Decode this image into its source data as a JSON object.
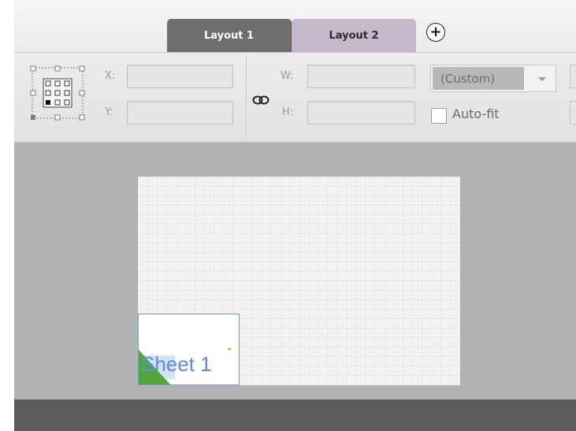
{
  "tabs": [
    {
      "label": "Layout 1",
      "state": "active"
    },
    {
      "label": "Layout 2",
      "state": "inactive"
    }
  ],
  "add_tab_icon": "plus-circle-icon",
  "toolbar": {
    "anchor_icon": "anchor-point-grid-icon",
    "x_label": "X:",
    "y_label": "Y:",
    "x_value": "",
    "y_value": "",
    "link_icon": "link-proportions-icon",
    "w_label": "W:",
    "h_label": "H:",
    "w_value": "",
    "h_value": "",
    "size_preset": "(Custom)",
    "autofit_label": "Auto-fit",
    "autofit_checked": false
  },
  "canvas": {
    "sheet_tile_label": "Sheet 1"
  },
  "colors": {
    "active_tab": "#6e6e6e",
    "inactive_tab": "#c5b8cc",
    "canvas_bg": "#b2b2b2",
    "status_bar": "#5b5b5b",
    "tile_border": "#6f9ad8",
    "tile_green": "#4fa63c"
  }
}
